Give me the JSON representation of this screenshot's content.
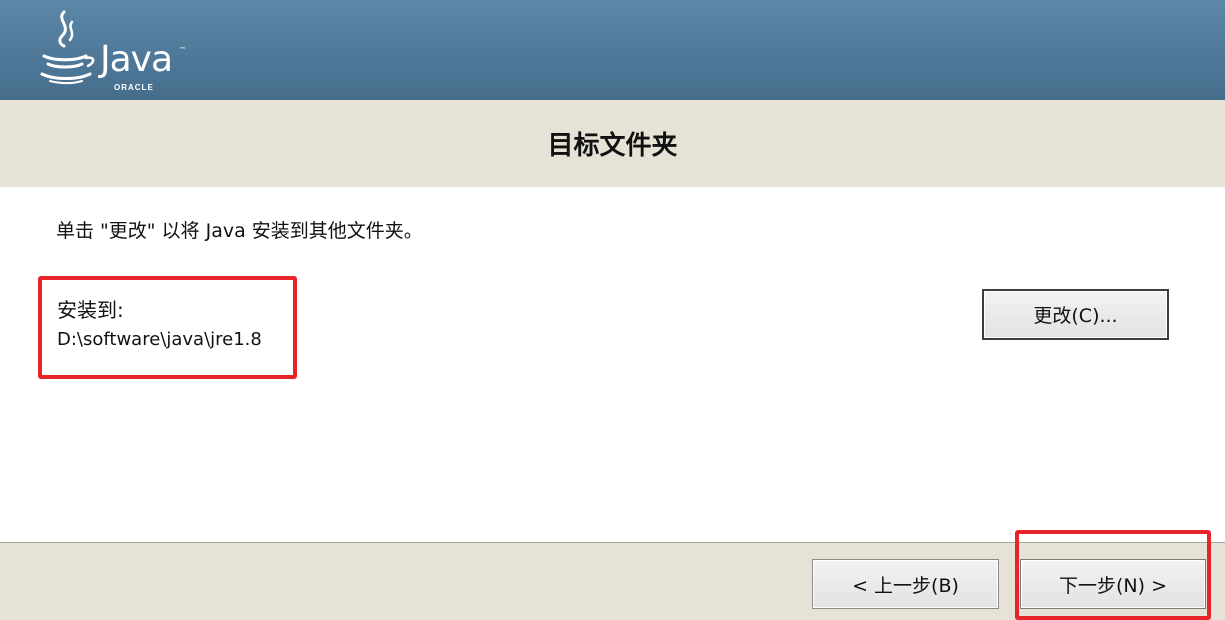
{
  "brand": {
    "wordmark": "Java",
    "trademark": "™",
    "vendor": "ORACLE"
  },
  "header": {
    "title": "目标文件夹"
  },
  "main": {
    "instruction": "单击 \"更改\" 以将 Java 安装到其他文件夹。",
    "install_to_label": "安装到:",
    "install_path": "D:\\software\\java\\jre1.8",
    "change_button": "更改(C)..."
  },
  "footer": {
    "back_button": "< 上一步(B)",
    "next_button": "下一步(N) >"
  },
  "colors": {
    "banner": "#4f7898",
    "title_strip": "#e6e2d5",
    "highlight": "#e8242b"
  }
}
